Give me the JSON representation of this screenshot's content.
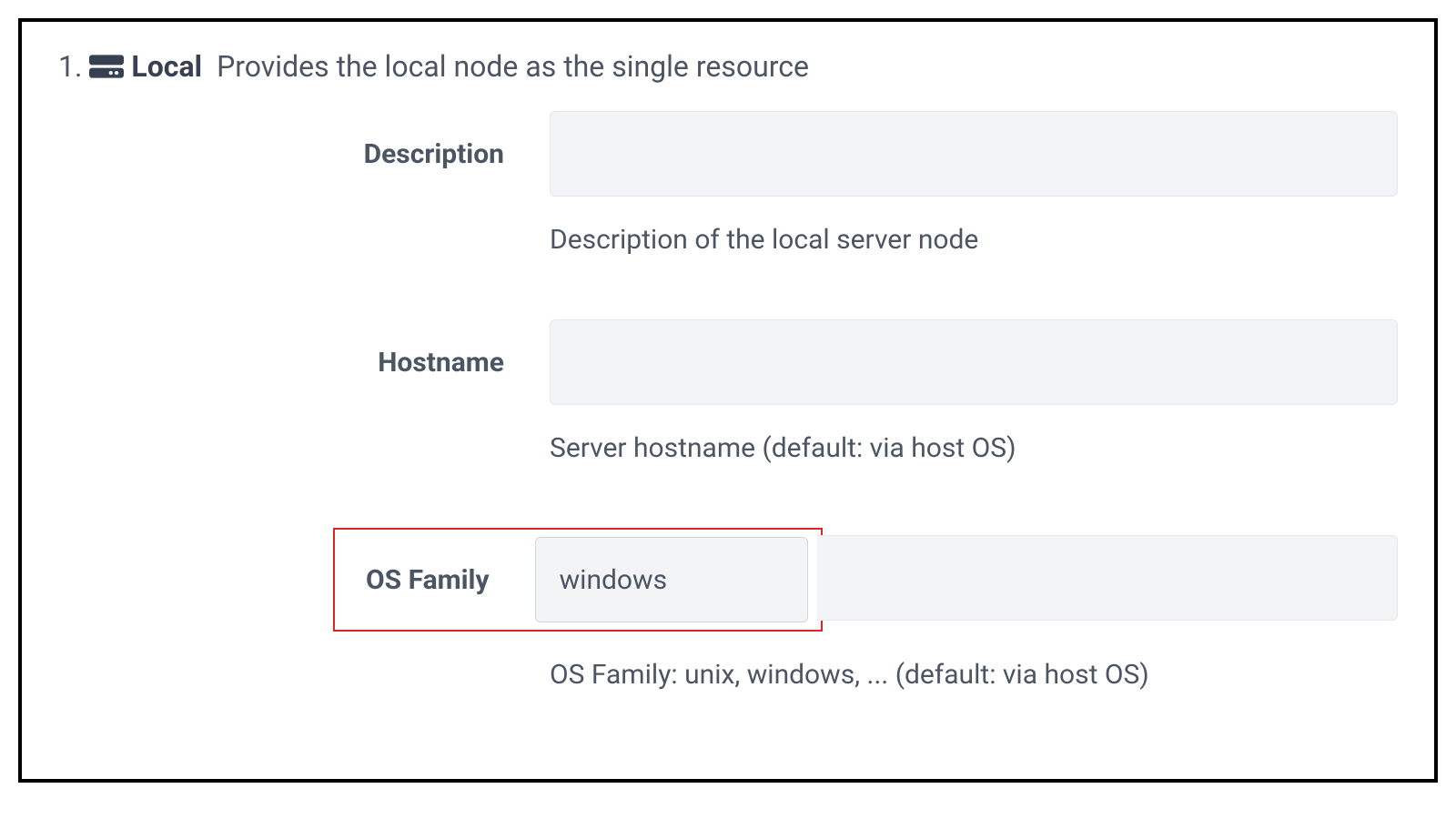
{
  "header": {
    "number": "1.",
    "icon": "server-icon",
    "title": "Local",
    "subtitle": "Provides the local node as the single resource"
  },
  "fields": {
    "description": {
      "label": "Description",
      "value": "",
      "help": "Description of the local server node"
    },
    "hostname": {
      "label": "Hostname",
      "value": "",
      "help": "Server hostname (default: via host OS)"
    },
    "osfamily": {
      "label": "OS Family",
      "value": "windows",
      "help": "OS Family: unix, windows, ... (default: via host OS)"
    }
  }
}
